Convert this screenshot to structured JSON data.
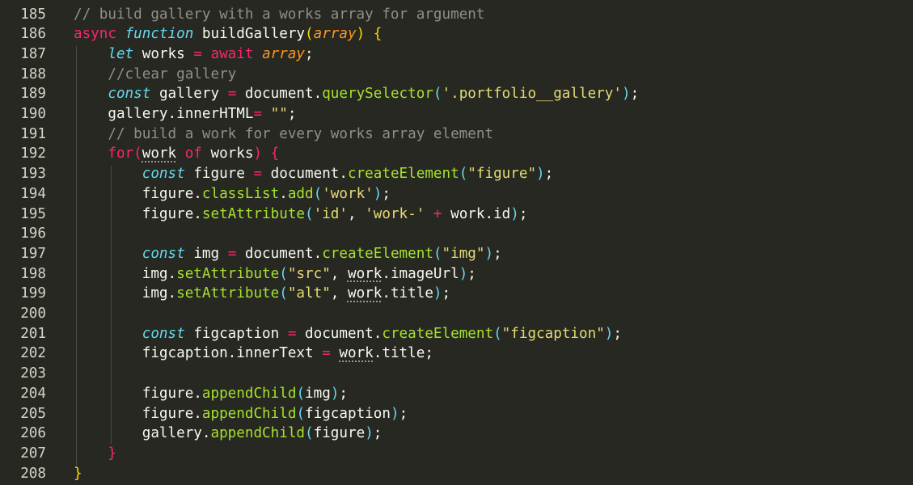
{
  "colors": {
    "background": "#272822",
    "text": "#f8f8f2",
    "line_number": "#d4d4c8",
    "comment": "#8f908a",
    "keyword": "#f92672",
    "storage": "#66d9ef",
    "argument": "#fd971f",
    "string": "#e6db74",
    "method": "#a6e22e",
    "paren": "#66d9ef",
    "brace": "#f92672",
    "brace_outer": "#ffd700"
  },
  "editor": {
    "lines": [
      {
        "number": "185",
        "tokens": [
          {
            "text": "// build gallery with a works array for argument",
            "type": "comment"
          }
        ]
      },
      {
        "number": "186",
        "tokens": [
          {
            "text": "async ",
            "type": "keyword"
          },
          {
            "text": "function ",
            "type": "storage_italic"
          },
          {
            "text": "buildGallery",
            "type": "plain"
          },
          {
            "text": "(",
            "type": "brace_outer"
          },
          {
            "text": "array",
            "type": "argument_italic"
          },
          {
            "text": ") {",
            "type": "brace_outer"
          }
        ]
      },
      {
        "number": "187",
        "tokens": [
          {
            "text": "    ",
            "type": "plain"
          },
          {
            "text": "let ",
            "type": "storage_italic"
          },
          {
            "text": "works ",
            "type": "plain"
          },
          {
            "text": "= ",
            "type": "keyword"
          },
          {
            "text": "await ",
            "type": "keyword"
          },
          {
            "text": "array",
            "type": "argument_italic"
          },
          {
            "text": ";",
            "type": "plain"
          }
        ]
      },
      {
        "number": "188",
        "tokens": [
          {
            "text": "    ",
            "type": "plain"
          },
          {
            "text": "//clear gallery",
            "type": "comment"
          }
        ]
      },
      {
        "number": "189",
        "tokens": [
          {
            "text": "    ",
            "type": "plain"
          },
          {
            "text": "const ",
            "type": "storage_italic"
          },
          {
            "text": "gallery ",
            "type": "plain"
          },
          {
            "text": "= ",
            "type": "keyword"
          },
          {
            "text": "document.",
            "type": "plain"
          },
          {
            "text": "querySelector",
            "type": "method"
          },
          {
            "text": "(",
            "type": "paren"
          },
          {
            "text": "'.portfolio__gallery'",
            "type": "string"
          },
          {
            "text": ")",
            "type": "paren"
          },
          {
            "text": ";",
            "type": "plain"
          }
        ]
      },
      {
        "number": "190",
        "tokens": [
          {
            "text": "    ",
            "type": "plain"
          },
          {
            "text": "gallery.innerHTML",
            "type": "plain"
          },
          {
            "text": "= ",
            "type": "keyword"
          },
          {
            "text": "\"\"",
            "type": "string"
          },
          {
            "text": ";",
            "type": "plain"
          }
        ]
      },
      {
        "number": "191",
        "tokens": [
          {
            "text": "    ",
            "type": "plain"
          },
          {
            "text": "// build a work for every works array element",
            "type": "comment"
          }
        ]
      },
      {
        "number": "192",
        "tokens": [
          {
            "text": "    ",
            "type": "plain"
          },
          {
            "text": "for",
            "type": "keyword"
          },
          {
            "text": "(",
            "type": "brace"
          },
          {
            "text": "work",
            "type": "squiggle"
          },
          {
            "text": " ",
            "type": "plain"
          },
          {
            "text": "of ",
            "type": "keyword"
          },
          {
            "text": "works",
            "type": "plain"
          },
          {
            "text": ") {",
            "type": "brace"
          }
        ]
      },
      {
        "number": "193",
        "tokens": [
          {
            "text": "        ",
            "type": "plain"
          },
          {
            "text": "const ",
            "type": "storage_italic"
          },
          {
            "text": "figure ",
            "type": "plain"
          },
          {
            "text": "= ",
            "type": "keyword"
          },
          {
            "text": "document.",
            "type": "plain"
          },
          {
            "text": "createElement",
            "type": "method"
          },
          {
            "text": "(",
            "type": "paren"
          },
          {
            "text": "\"figure\"",
            "type": "string"
          },
          {
            "text": ")",
            "type": "paren"
          },
          {
            "text": ";",
            "type": "plain"
          }
        ]
      },
      {
        "number": "194",
        "tokens": [
          {
            "text": "        ",
            "type": "plain"
          },
          {
            "text": "figure.",
            "type": "plain"
          },
          {
            "text": "classList",
            "type": "method"
          },
          {
            "text": ".",
            "type": "plain"
          },
          {
            "text": "add",
            "type": "method"
          },
          {
            "text": "(",
            "type": "paren"
          },
          {
            "text": "'work'",
            "type": "string"
          },
          {
            "text": ")",
            "type": "paren"
          },
          {
            "text": ";",
            "type": "plain"
          }
        ]
      },
      {
        "number": "195",
        "tokens": [
          {
            "text": "        ",
            "type": "plain"
          },
          {
            "text": "figure.",
            "type": "plain"
          },
          {
            "text": "setAttribute",
            "type": "method"
          },
          {
            "text": "(",
            "type": "paren"
          },
          {
            "text": "'id'",
            "type": "string"
          },
          {
            "text": ", ",
            "type": "plain"
          },
          {
            "text": "'work-'",
            "type": "string"
          },
          {
            "text": " + ",
            "type": "keyword"
          },
          {
            "text": "work.id",
            "type": "plain"
          },
          {
            "text": ")",
            "type": "paren"
          },
          {
            "text": ";",
            "type": "plain"
          }
        ]
      },
      {
        "number": "196",
        "tokens": []
      },
      {
        "number": "197",
        "tokens": [
          {
            "text": "        ",
            "type": "plain"
          },
          {
            "text": "const ",
            "type": "storage_italic"
          },
          {
            "text": "img ",
            "type": "plain"
          },
          {
            "text": "= ",
            "type": "keyword"
          },
          {
            "text": "document.",
            "type": "plain"
          },
          {
            "text": "createElement",
            "type": "method"
          },
          {
            "text": "(",
            "type": "paren"
          },
          {
            "text": "\"img\"",
            "type": "string"
          },
          {
            "text": ")",
            "type": "paren"
          },
          {
            "text": ";",
            "type": "plain"
          }
        ]
      },
      {
        "number": "198",
        "tokens": [
          {
            "text": "        ",
            "type": "plain"
          },
          {
            "text": "img.",
            "type": "plain"
          },
          {
            "text": "setAttribute",
            "type": "method"
          },
          {
            "text": "(",
            "type": "paren"
          },
          {
            "text": "\"src\"",
            "type": "string"
          },
          {
            "text": ", ",
            "type": "plain"
          },
          {
            "text": "work",
            "type": "squiggle"
          },
          {
            "text": ".imageUrl",
            "type": "plain"
          },
          {
            "text": ")",
            "type": "paren"
          },
          {
            "text": ";",
            "type": "plain"
          }
        ]
      },
      {
        "number": "199",
        "tokens": [
          {
            "text": "        ",
            "type": "plain"
          },
          {
            "text": "img.",
            "type": "plain"
          },
          {
            "text": "setAttribute",
            "type": "method"
          },
          {
            "text": "(",
            "type": "paren"
          },
          {
            "text": "\"alt\"",
            "type": "string"
          },
          {
            "text": ", ",
            "type": "plain"
          },
          {
            "text": "work",
            "type": "squiggle"
          },
          {
            "text": ".title",
            "type": "plain"
          },
          {
            "text": ")",
            "type": "paren"
          },
          {
            "text": ";",
            "type": "plain"
          }
        ]
      },
      {
        "number": "200",
        "tokens": []
      },
      {
        "number": "201",
        "tokens": [
          {
            "text": "        ",
            "type": "plain"
          },
          {
            "text": "const ",
            "type": "storage_italic"
          },
          {
            "text": "figcaption ",
            "type": "plain"
          },
          {
            "text": "= ",
            "type": "keyword"
          },
          {
            "text": "document.",
            "type": "plain"
          },
          {
            "text": "createElement",
            "type": "method"
          },
          {
            "text": "(",
            "type": "paren"
          },
          {
            "text": "\"figcaption\"",
            "type": "string"
          },
          {
            "text": ")",
            "type": "paren"
          },
          {
            "text": ";",
            "type": "plain"
          }
        ]
      },
      {
        "number": "202",
        "tokens": [
          {
            "text": "        ",
            "type": "plain"
          },
          {
            "text": "figcaption.innerText ",
            "type": "plain"
          },
          {
            "text": "= ",
            "type": "keyword"
          },
          {
            "text": "work",
            "type": "squiggle"
          },
          {
            "text": ".title;",
            "type": "plain"
          }
        ]
      },
      {
        "number": "203",
        "tokens": []
      },
      {
        "number": "204",
        "tokens": [
          {
            "text": "        ",
            "type": "plain"
          },
          {
            "text": "figure.",
            "type": "plain"
          },
          {
            "text": "appendChild",
            "type": "method"
          },
          {
            "text": "(",
            "type": "paren"
          },
          {
            "text": "img",
            "type": "plain"
          },
          {
            "text": ")",
            "type": "paren"
          },
          {
            "text": ";",
            "type": "plain"
          }
        ]
      },
      {
        "number": "205",
        "tokens": [
          {
            "text": "        ",
            "type": "plain"
          },
          {
            "text": "figure.",
            "type": "plain"
          },
          {
            "text": "appendChild",
            "type": "method"
          },
          {
            "text": "(",
            "type": "paren"
          },
          {
            "text": "figcaption",
            "type": "plain"
          },
          {
            "text": ")",
            "type": "paren"
          },
          {
            "text": ";",
            "type": "plain"
          }
        ]
      },
      {
        "number": "206",
        "tokens": [
          {
            "text": "        ",
            "type": "plain"
          },
          {
            "text": "gallery.",
            "type": "plain"
          },
          {
            "text": "appendChild",
            "type": "method"
          },
          {
            "text": "(",
            "type": "paren"
          },
          {
            "text": "figure",
            "type": "plain"
          },
          {
            "text": ")",
            "type": "paren"
          },
          {
            "text": ";",
            "type": "plain"
          }
        ]
      },
      {
        "number": "207",
        "tokens": [
          {
            "text": "    ",
            "type": "plain"
          },
          {
            "text": "}",
            "type": "brace"
          }
        ]
      },
      {
        "number": "208",
        "tokens": [
          {
            "text": "}",
            "type": "brace_outer"
          }
        ]
      }
    ]
  }
}
